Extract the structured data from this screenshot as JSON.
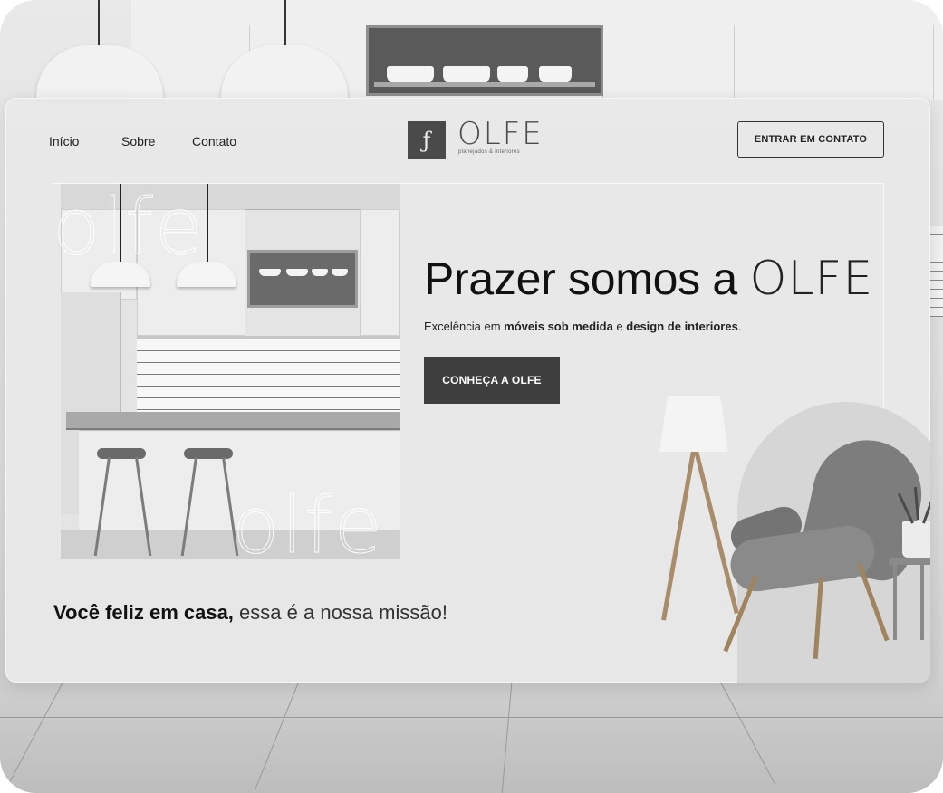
{
  "nav": {
    "links": [
      "Início",
      "Sobre",
      "Contato"
    ],
    "logo_mark": "ƒ",
    "logo_name": "OLFE",
    "logo_tagline": "planejados & interiores",
    "contact_button": "ENTRAR EM CONTATO"
  },
  "hero": {
    "title_bold": "Prazer somos a ",
    "title_light": "OLFE",
    "subtitle_pre": "Excelência em ",
    "subtitle_b1": "móveis sob medida",
    "subtitle_mid": " e ",
    "subtitle_b2": "design de interiores",
    "subtitle_end": ".",
    "cta_button": "CONHEÇA A OLFE"
  },
  "watermark": {
    "top": "olfe",
    "bottom": "olfe"
  },
  "mission": {
    "bold": "Você feliz em casa,",
    "rest": " essa é a nossa missão!"
  }
}
